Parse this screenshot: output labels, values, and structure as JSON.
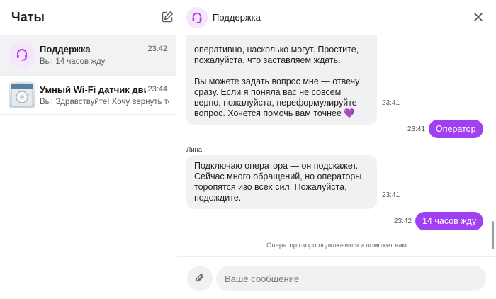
{
  "sidebar": {
    "title": "Чаты",
    "chats": [
      {
        "name": "Поддержка",
        "time": "23:42",
        "preview": "Вы: 14 часов жду"
      },
      {
        "name": "Умный Wi-Fi датчик движения",
        "time": "23:44",
        "preview": "Вы: Здравствуйте! Хочу вернуть товар"
      }
    ]
  },
  "header": {
    "title": "Поддержка"
  },
  "messages": {
    "m1_text": "оперативно, насколько могут. Простите, пожалуйста, что заставляем ждать.",
    "m1_text2": "Вы можете задать вопрос мне — отвечу сразу. Если я поняла вас не совсем верно, пожалуйста, переформулируйте вопрос. Хочется помочь вам точнее 💜",
    "m1_time": "23:41",
    "m2_text": "Оператор",
    "m2_time": "23:41",
    "sender": "Лина",
    "m3_text": "Подключаю оператора — он подскажет. Сейчас много обращений, но операторы торопятся изо всех сил. Пожалуйста, подождите.",
    "m3_time": "23:41",
    "m4_text": "14 часов жду",
    "m4_time": "23:42",
    "system_note": "Оператор скоро подключится и поможет вам"
  },
  "composer": {
    "placeholder": "Ваше сообщение"
  },
  "colors": {
    "accent": "#a13ff2",
    "bubble_in": "#f1f1f4",
    "avatar_bg": "#f6e6fb"
  },
  "icons": [
    "compose-icon",
    "headset-icon",
    "close-icon",
    "paperclip-icon"
  ]
}
